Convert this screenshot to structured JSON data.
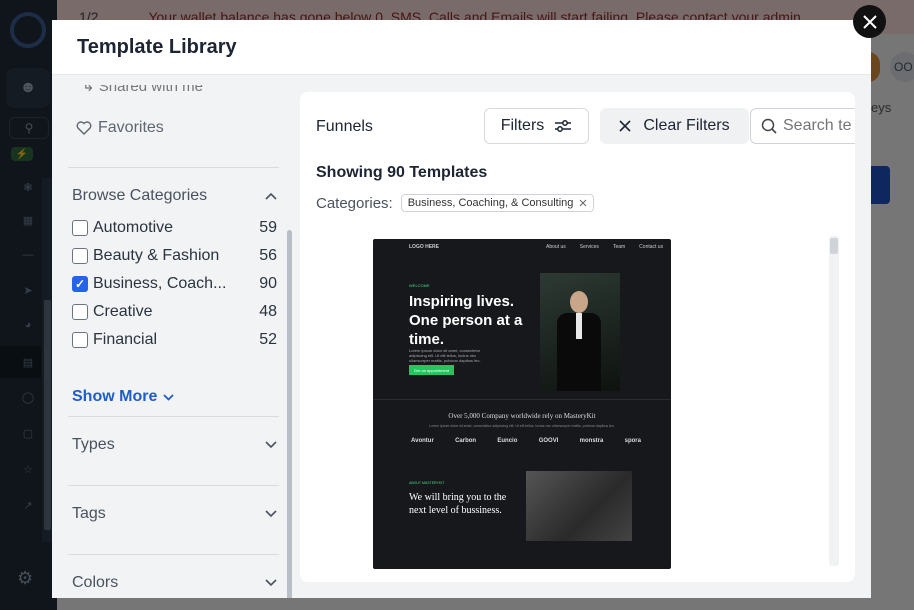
{
  "background": {
    "pager": "1/2",
    "banner_text": "Your wallet balance has gone below 0. SMS, Calls and Emails will start failing. Please contact your admin",
    "right_text": "eys",
    "avatar_initials": "OO"
  },
  "modal": {
    "title": "Template Library",
    "close_icon": "close-icon"
  },
  "left_panel": {
    "shared_label": "Shared with me",
    "favorites_label": "Favorites",
    "browse_categories_label": "Browse Categories",
    "categories": [
      {
        "label": "Automotive",
        "count": "59",
        "checked": false
      },
      {
        "label": "Beauty & Fashion",
        "count": "56",
        "checked": false
      },
      {
        "label": "Business, Coach...",
        "count": "90",
        "checked": true
      },
      {
        "label": "Creative",
        "count": "48",
        "checked": false
      },
      {
        "label": "Financial",
        "count": "52",
        "checked": false
      }
    ],
    "show_more_label": "Show More",
    "types_label": "Types",
    "tags_label": "Tags",
    "colors_label": "Colors"
  },
  "right_panel": {
    "funnels_label": "Funnels",
    "filters_label": "Filters",
    "clear_filters_label": "Clear Filters",
    "search_placeholder": "Search te",
    "showing_label": "Showing 90 Templates",
    "categories_label": "Categories:",
    "active_chip": "Business, Coaching, & Consulting"
  },
  "template_preview": {
    "logo": "LOGO HERE",
    "nav_links": [
      "About us",
      "Services",
      "Team",
      "Contact us"
    ],
    "welcome": "WELCOME",
    "headline": "Inspiring lives. One person at a time.",
    "body": "Lorem ipsum dolor sit amet, consectetur adipiscing elit. Ut elit tellus, luctus nec ullamcorper mattis, pulvinar dapibus leo.",
    "cta": "Get an appointment",
    "band_title": "Over 5,000 Company worldwide rely on MasteryKit",
    "band_body": "Lorem ipsum dolor sit amet, consectetur adipiscing elit. Ut elit tellus, luctus nec ullamcorper mattis, pulvinar dapibus leo.",
    "brands": [
      "Avontur",
      "Carbon",
      "Euncio",
      "GOOVI",
      "monstra",
      "spora"
    ],
    "about_label": "ABOUT MASTERYKIT",
    "sub_headline": "We will bring you to the next level of bussiness."
  }
}
